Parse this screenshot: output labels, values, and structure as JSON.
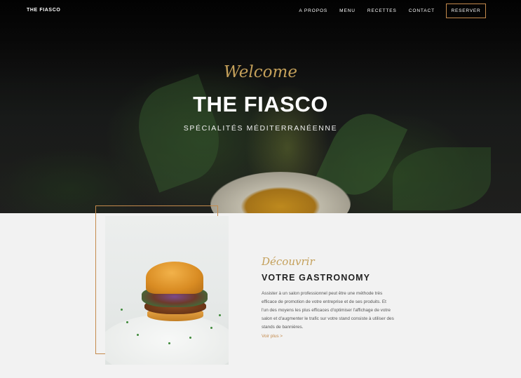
{
  "nav": {
    "brand": "THE FIASCO",
    "menu": [
      "A PROPOS",
      "MENU",
      "RECETTES",
      "CONTACT"
    ],
    "reserve_label": "RESERVER"
  },
  "hero": {
    "script": "Welcome",
    "title": "THE FIASCO",
    "subtitle": "SPÉCIALITÉS MÉDITERRANÉENNE"
  },
  "about": {
    "script": "Découvrir",
    "title": "VOTRE GASTRONOMY",
    "lines": [
      "Assister à un salon professionnel peut être une méthode très",
      "efficace de promotion de votre entreprise et de ses produits. Et",
      "l'un des moyens les plus efficaces d'optimiser l'affichage de votre",
      "salon et d'augmenter le trafic sur votre stand consiste à utiliser des",
      "stands de bannières."
    ],
    "more_label": "Voir plus  >"
  },
  "colors": {
    "accent": "#c48a4c",
    "script_gold": "#c4a05a",
    "section_bg": "#f2f2f2"
  }
}
